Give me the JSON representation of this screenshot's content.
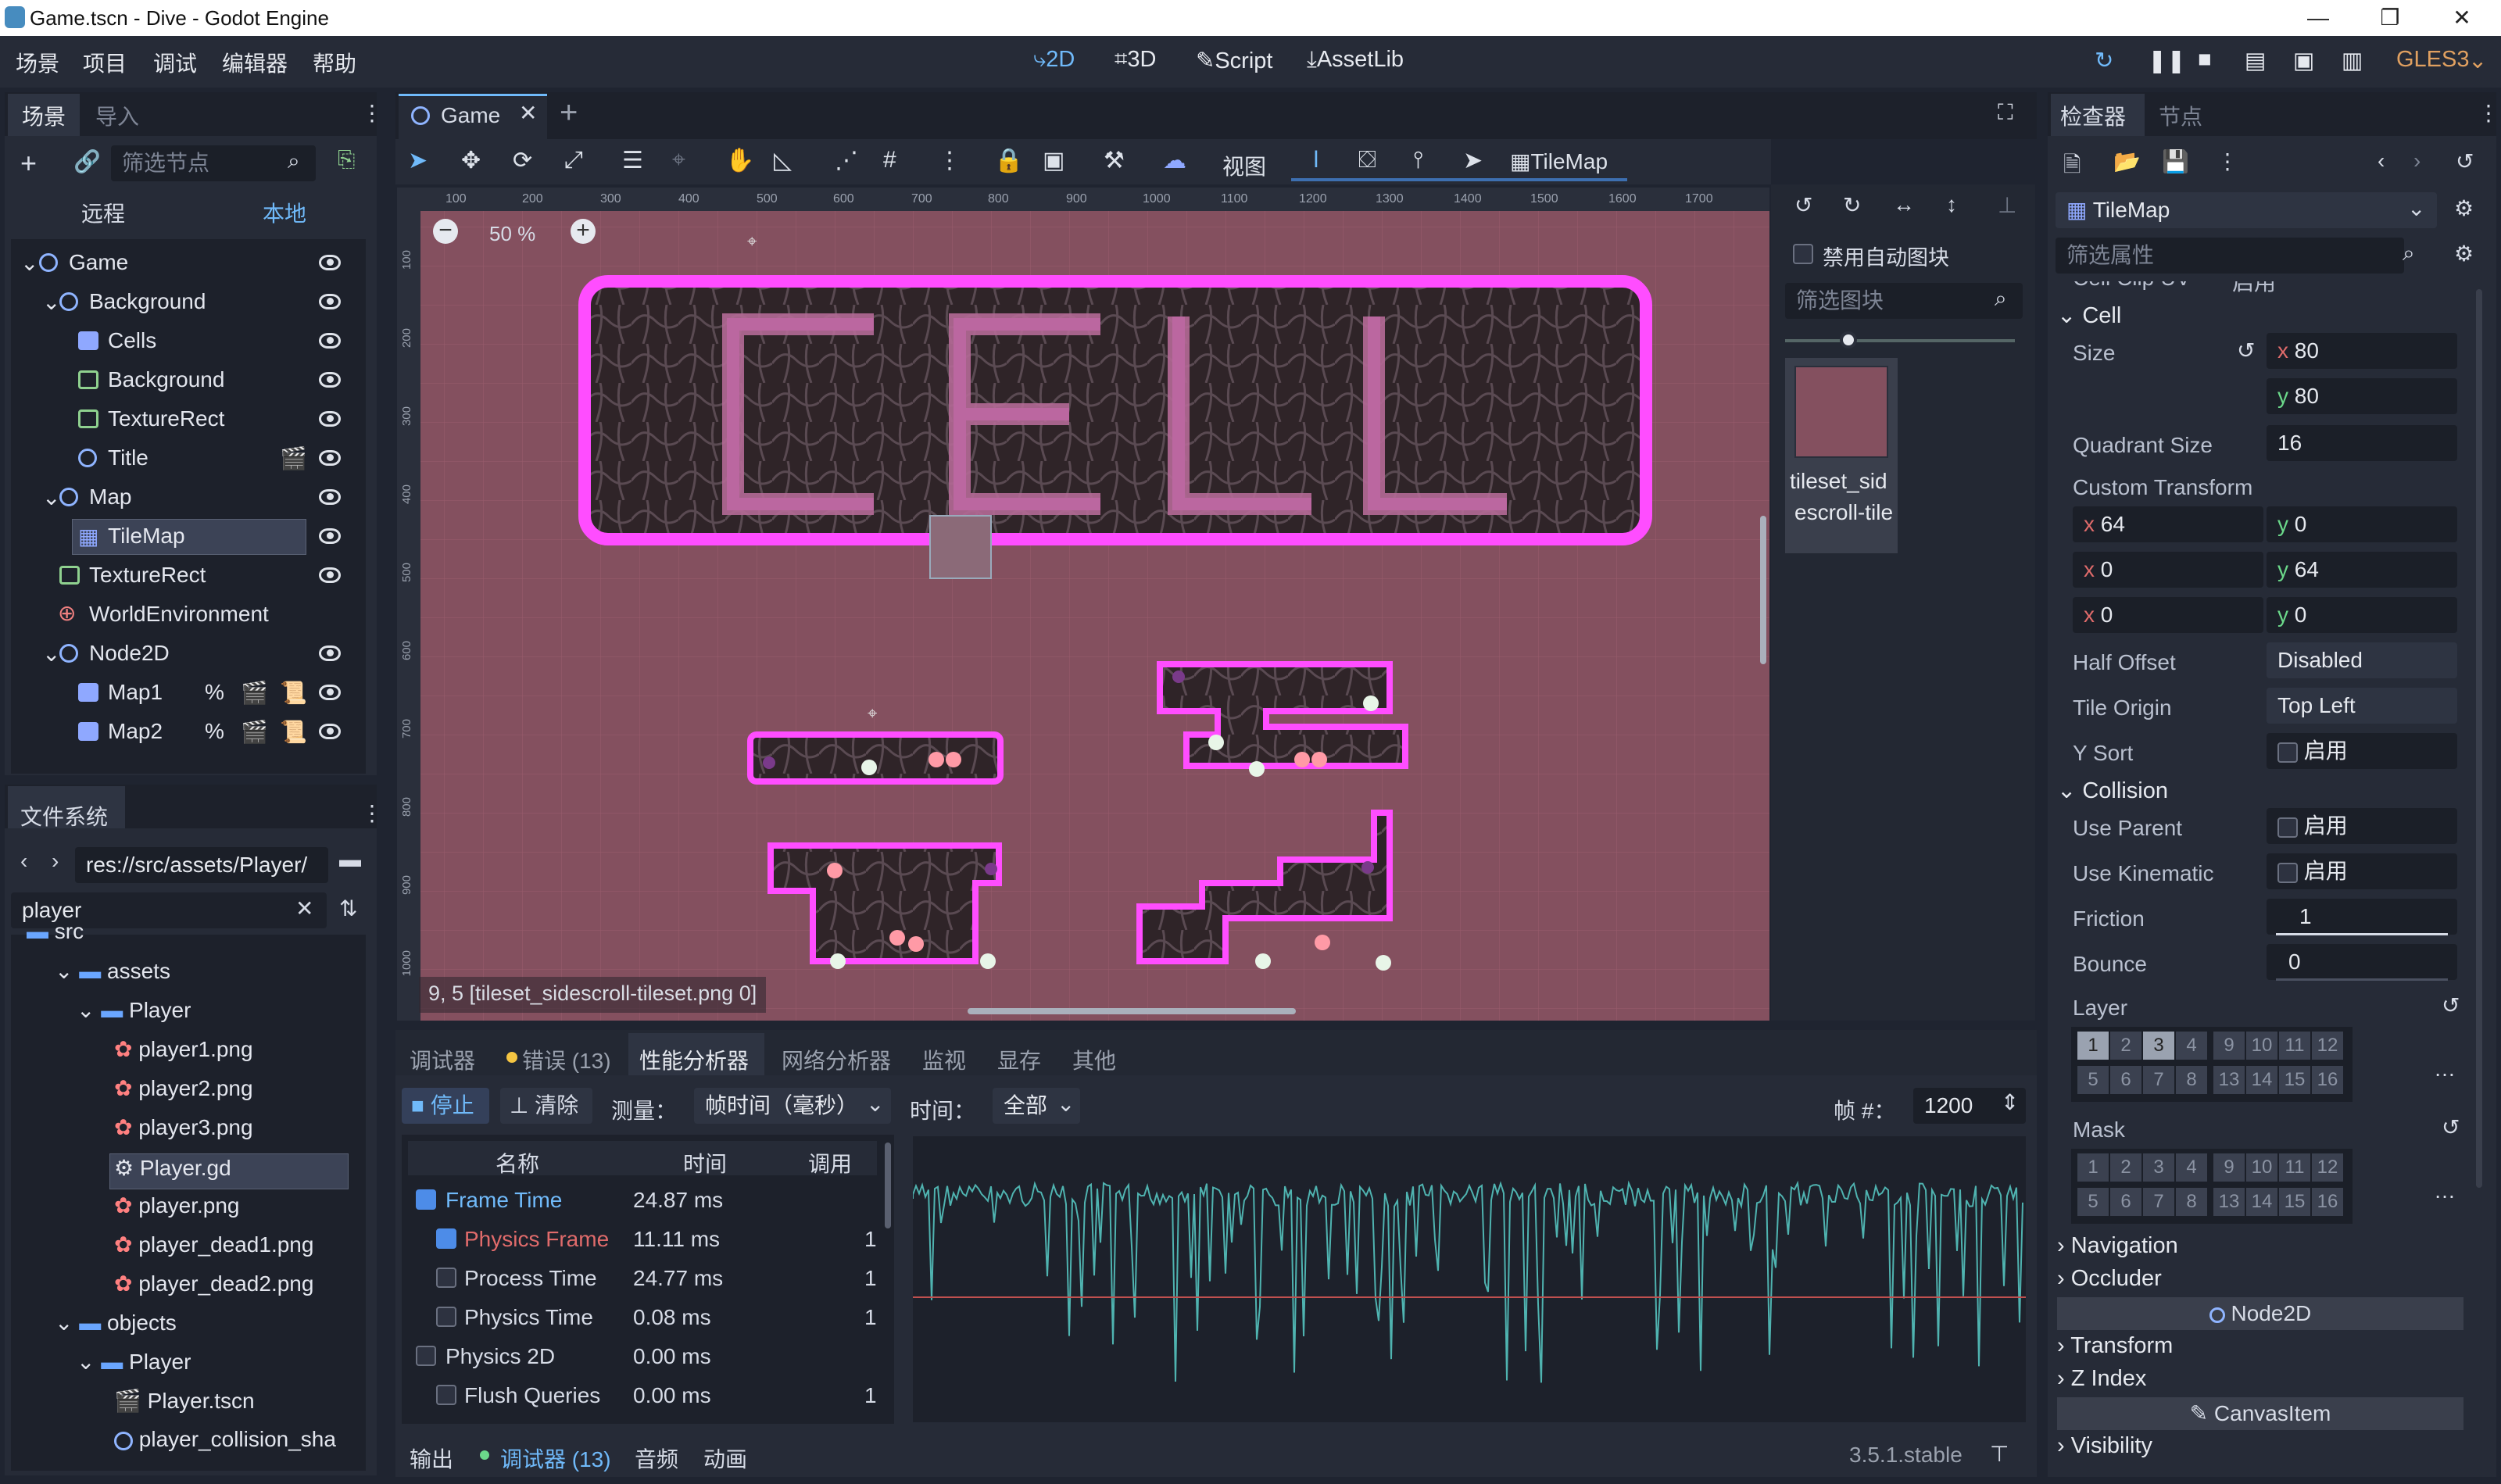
{
  "window": {
    "title": "Game.tscn - Dive - Godot Engine"
  },
  "menu": [
    "场景",
    "项目",
    "调试",
    "编辑器",
    "帮助"
  ],
  "workspaces": {
    "w2d": "2D",
    "w3d": "3D",
    "script": "Script",
    "assetlib": "AssetLib"
  },
  "renderer": "GLES3",
  "scene_dock": {
    "tabs": [
      "场景",
      "导入"
    ],
    "filter_placeholder": "筛选节点",
    "remote": "远程",
    "local": "本地",
    "nodes": [
      "Game",
      "Background",
      "Cells",
      "Background",
      "TextureRect",
      "Title",
      "Map",
      "TileMap",
      "TextureRect",
      "WorldEnvironment",
      "Node2D",
      "Map1",
      "Map2"
    ]
  },
  "filesystem": {
    "title": "文件系统",
    "path": "res://src/assets/Player/",
    "search": "player",
    "items": [
      "src",
      "assets",
      "Player",
      "player1.png",
      "player2.png",
      "player3.png",
      "Player.gd",
      "player.png",
      "player_dead1.png",
      "player_dead2.png",
      "objects",
      "Player",
      "Player.tscn",
      "player_collision_sha"
    ]
  },
  "editor_tab": "Game",
  "canvas_toolbar": {
    "view": "视图",
    "tilemap": "TileMap"
  },
  "zoom": "50 %",
  "ruler": [
    "100",
    "200",
    "300",
    "400",
    "500",
    "600",
    "700",
    "800",
    "900",
    "1000",
    "1100",
    "1200",
    "1300",
    "1400",
    "1500",
    "1600",
    "1700"
  ],
  "vruler": [
    "100",
    "200",
    "300",
    "400",
    "500",
    "600",
    "700",
    "800",
    "900",
    "1000"
  ],
  "status": "9, 5 [tileset_sidescroll-tileset.png 0]",
  "tile_panel": {
    "disable_autotile": "禁用自动图块",
    "filter_placeholder": "筛选图块",
    "tile_name1": "tileset_sid",
    "tile_name2": "escroll-tile"
  },
  "bottom_tabs": [
    "调试器",
    "错误 (13)",
    "性能分析器",
    "网络分析器",
    "监视",
    "显存",
    "其他"
  ],
  "profiler": {
    "stop": "停止",
    "clear": "清除",
    "measure_label": "测量：",
    "measure_value": "帧时间（毫秒）",
    "time_label": "时间：",
    "time_value": "全部",
    "frame_label": "帧 #：",
    "frame_value": "1200",
    "col_name": "名称",
    "col_time": "时间",
    "col_calls": "调用",
    "rows": [
      {
        "name": "Frame Time",
        "time": "24.87 ms",
        "calls": ""
      },
      {
        "name": "Physics Frame",
        "time": "11.11 ms",
        "calls": "1"
      },
      {
        "name": "Process Time",
        "time": "24.77 ms",
        "calls": "1"
      },
      {
        "name": "Physics Time",
        "time": "0.08 ms",
        "calls": "1"
      },
      {
        "name": "Physics 2D",
        "time": "0.00 ms",
        "calls": ""
      },
      {
        "name": "Flush Queries",
        "time": "0.00 ms",
        "calls": "1"
      }
    ]
  },
  "bottom_bar": {
    "output": "输出",
    "debugger": "调试器 (13)",
    "audio": "音频",
    "animation": "动画",
    "version": "3.5.1.stable"
  },
  "inspector": {
    "tabs": [
      "检查器",
      "节点"
    ],
    "node": "TileMap",
    "filter_placeholder": "筛选属性",
    "cut_label": "Cell Clip UV",
    "cut_value": "启用",
    "cell": "Cell",
    "size_label": "Size",
    "size_x": "80",
    "size_y": "80",
    "quadrant_label": "Quadrant Size",
    "quadrant_value": "16",
    "custom_transform": "Custom Transform",
    "ct": [
      "64",
      "0",
      "0",
      "64",
      "0",
      "0"
    ],
    "half_offset_label": "Half Offset",
    "half_offset_value": "Disabled",
    "tile_origin_label": "Tile Origin",
    "tile_origin_value": "Top Left",
    "ysort_label": "Y Sort",
    "on": "启用",
    "collision": "Collision",
    "use_parent": "Use Parent",
    "use_kinematic": "Use Kinematic",
    "friction_label": "Friction",
    "friction_value": "1",
    "bounce_label": "Bounce",
    "bounce_value": "0",
    "layer": "Layer",
    "mask": "Mask",
    "nums1": [
      "1",
      "2",
      "3",
      "4",
      "9",
      "10",
      "11",
      "12"
    ],
    "nums2": [
      "5",
      "6",
      "7",
      "8",
      "13",
      "14",
      "15",
      "16"
    ],
    "navigation": "Navigation",
    "occluder": "Occluder",
    "node2d": "Node2D",
    "transform": "Transform",
    "zindex": "Z Index",
    "canvasitem": "CanvasItem",
    "visibility": "Visibility"
  },
  "colors": {
    "accent": "#70bafa",
    "canvas_bg": "#84505f",
    "neon": "#ff4dff"
  }
}
